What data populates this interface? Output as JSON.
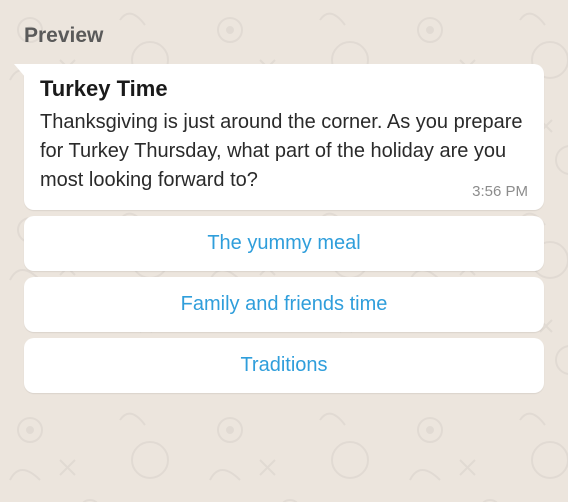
{
  "header": {
    "preview_label": "Preview"
  },
  "message": {
    "title": "Turkey Time",
    "body": "Thanksgiving is just around the corner. As you prepare for Turkey Thursday, what part of the holiday are you most looking forward to?",
    "time": "3:56 PM"
  },
  "options": [
    "The yummy meal",
    "Family and friends time",
    "Traditions"
  ]
}
